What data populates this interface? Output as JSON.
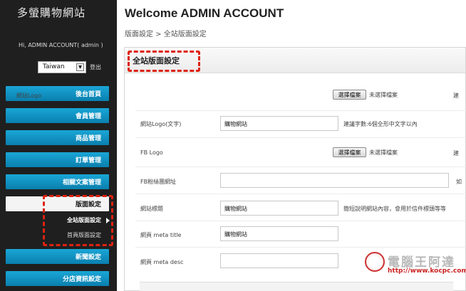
{
  "sidebar": {
    "site_title": "多螢購物網站",
    "greeting": "Hi, ADMIN ACCOUNT( admin )",
    "language": "Taiwan",
    "logout": "登出",
    "nav": [
      {
        "label": "後台首頁"
      },
      {
        "label": "會員管理"
      },
      {
        "label": "商品管理"
      },
      {
        "label": "訂單管理"
      },
      {
        "label": "相關文案管理"
      },
      {
        "label": "版面設定"
      },
      {
        "label": "新聞設定"
      },
      {
        "label": "分店資訊設定"
      }
    ],
    "sub_items": [
      {
        "label": "全站版面設定"
      },
      {
        "label": "首頁版面設定"
      }
    ]
  },
  "header": {
    "title": "Welcome ADMIN ACCOUNT",
    "breadcrumb": "版面設定 > 全站版面設定"
  },
  "panel": {
    "title": "全站版面設定",
    "fields": {
      "logo_label": "網站Logo",
      "logo_text_label": "網站Logo(文字)",
      "logo_text_value": "購物網站",
      "logo_text_hint": "建議字數:6個全形中文字以內",
      "fb_logo_label": "FB Logo",
      "fb_fans_label": "FB粉絲團網址",
      "site_title_label": "網站標題",
      "site_title_value": "購物網站",
      "site_title_hint": "簡短說明網站內容，會用於信件標頭等等",
      "meta_title_label": "網頁 meta title",
      "meta_title_value": "購物網站",
      "meta_desc_label": "網頁 meta desc"
    },
    "file_button": "選擇檔案",
    "file_status": "未選擇檔案",
    "cut_hint_1": "建",
    "cut_hint_2": "建",
    "cut_hint_3": "如"
  },
  "watermark": {
    "text": "電腦王阿達",
    "url": "http://www.kocpc.com.tw"
  }
}
